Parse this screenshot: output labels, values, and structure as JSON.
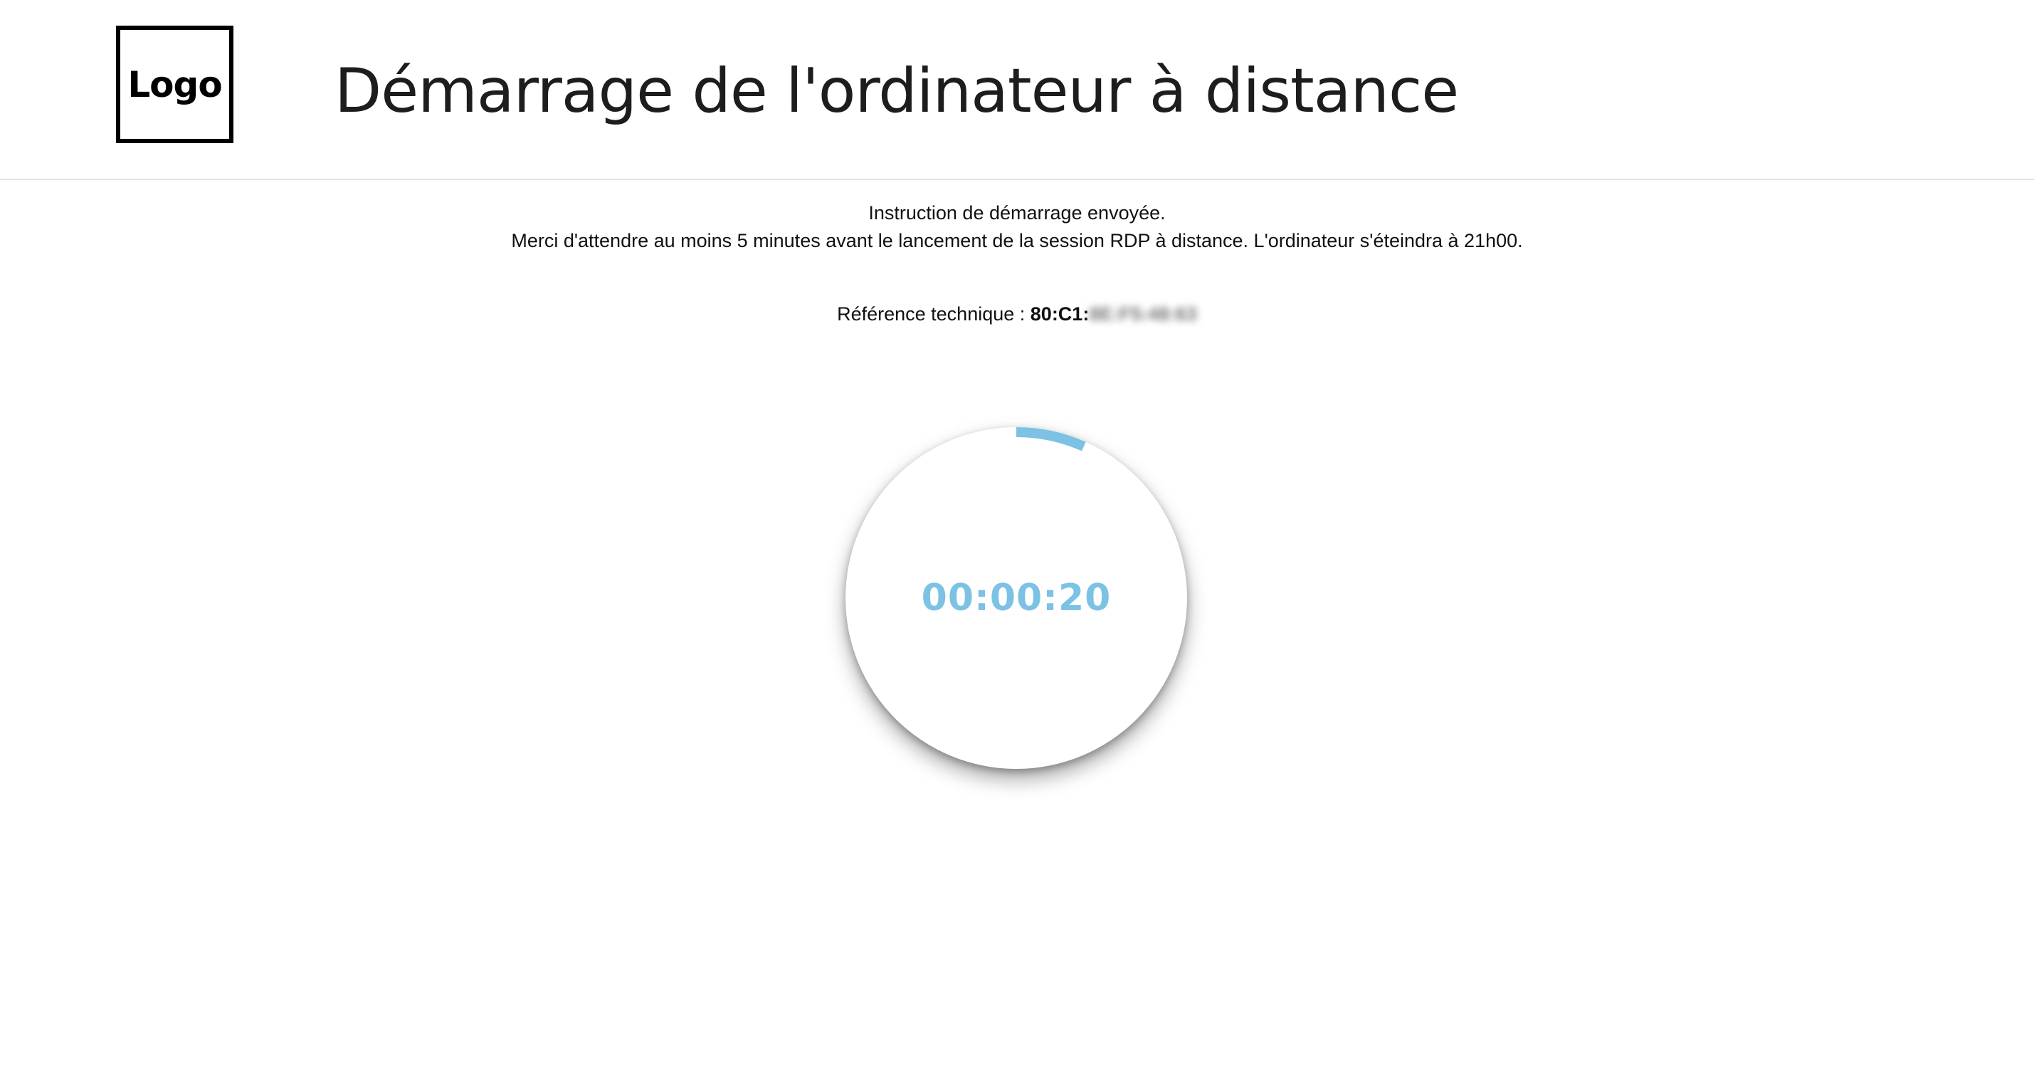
{
  "header": {
    "logo_text": "Logo",
    "title": "Démarrage de l'ordinateur à distance"
  },
  "status": {
    "line1": "Instruction de démarrage envoyée.",
    "line2": "Merci d'attendre au moins 5 minutes avant le lancement de la session RDP à distance. L'ordinateur s'éteindra à 21h00."
  },
  "technical_reference": {
    "label": "Référence technique : ",
    "value_visible": "80:C1:",
    "value_obscured": "8E:F5:48:63"
  },
  "timer": {
    "elapsed": "00:00:20",
    "progress_fraction": 0.0667
  },
  "colors": {
    "accent": "#7cc2e4",
    "divider": "#e3e3e3",
    "title": "#1d1d1f"
  }
}
